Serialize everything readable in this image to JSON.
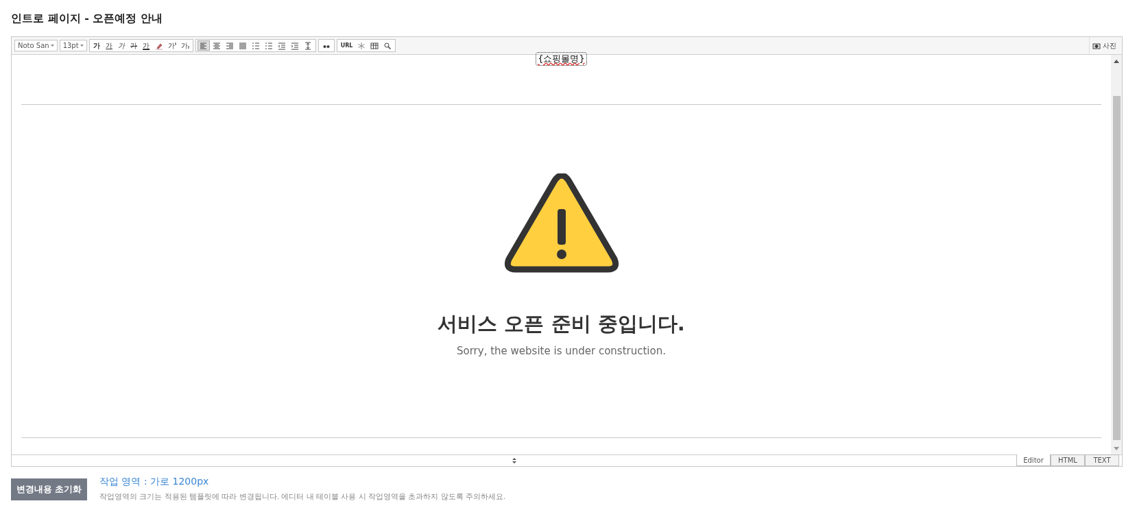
{
  "title": "인트로 페이지 - 오픈예정 안내",
  "toolbar": {
    "font": "Noto San",
    "size": "13pt",
    "format_buttons": [
      {
        "kind": "bold",
        "label": "가"
      },
      {
        "kind": "underline",
        "label": "가"
      },
      {
        "kind": "italic",
        "label": "가"
      },
      {
        "kind": "strike",
        "label": "가"
      },
      {
        "kind": "color",
        "label": "가"
      }
    ],
    "script_buttons": [
      {
        "kind": "superscript",
        "label": "가"
      },
      {
        "kind": "subscript",
        "label": "가"
      }
    ],
    "align": [
      {
        "kind": "left",
        "selected": true
      },
      {
        "kind": "center",
        "selected": false
      },
      {
        "kind": "right",
        "selected": false
      },
      {
        "kind": "justify",
        "selected": false
      }
    ],
    "url_label": "URL",
    "photo_label": "사진"
  },
  "document": {
    "shop_name": "{쇼핑몰명}",
    "heading": "서비스 오픈 준비 중입니다.",
    "subheading": "Sorry, the website is under construction."
  },
  "mode_tabs": [
    {
      "label": "Editor",
      "selected": true
    },
    {
      "label": "HTML",
      "selected": false
    },
    {
      "label": "TEXT",
      "selected": false
    }
  ],
  "footer": {
    "reset_button": "변경내용 초기화",
    "work_area": "작업 영역 : 가로 1200px",
    "note": "작업영역의 크기는 적용된 템플릿에 따라 변경됩니다. 에디터 내 테이블 사용 시 작업영역을 초과하지 않도록 주의하세요."
  }
}
